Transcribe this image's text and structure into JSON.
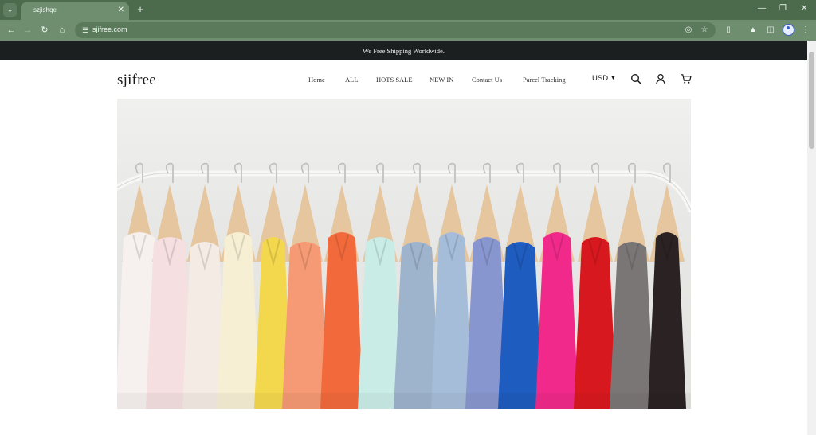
{
  "browser": {
    "tab_title": "szjishqe",
    "url": "sjifree.com",
    "icons": {
      "tab_search": "chevron-down-icon",
      "tab_close": "close-icon",
      "new_tab": "plus-icon",
      "minimize": "minimize-icon",
      "restore": "restore-icon",
      "close_window": "close-icon",
      "back": "arrow-left-icon",
      "forward": "arrow-right-icon",
      "reload": "reload-icon",
      "home": "home-icon",
      "site_info": "tune-icon",
      "eye_off": "eye-off-icon",
      "bookmark": "star-icon",
      "extensions": "puzzle-icon",
      "labs": "flask-icon",
      "side_panel": "side-panel-icon",
      "profile": "profile-icon",
      "menu": "kebab-menu-icon"
    },
    "colors": {
      "frame": "#4c6b4d",
      "toolbar": "#6f8e6f",
      "omnibox": "#5b7a5c"
    }
  },
  "site": {
    "announcement": "We Free Shipping Worldwide.",
    "logo": "sjifree",
    "nav": [
      "Home",
      "ALL",
      "HOTS SALE",
      "NEW IN",
      "Contact Us",
      "Parcel Tracking"
    ],
    "currency": "USD",
    "icons": {
      "search": "search-icon",
      "account": "user-icon",
      "cart": "cart-icon",
      "currency_caret": "caret-down-icon"
    },
    "hero": {
      "image": "clothes-rack-hero"
    },
    "colors": {
      "announcement_bg": "#1c1f20",
      "text": "#1a1a1a"
    }
  }
}
